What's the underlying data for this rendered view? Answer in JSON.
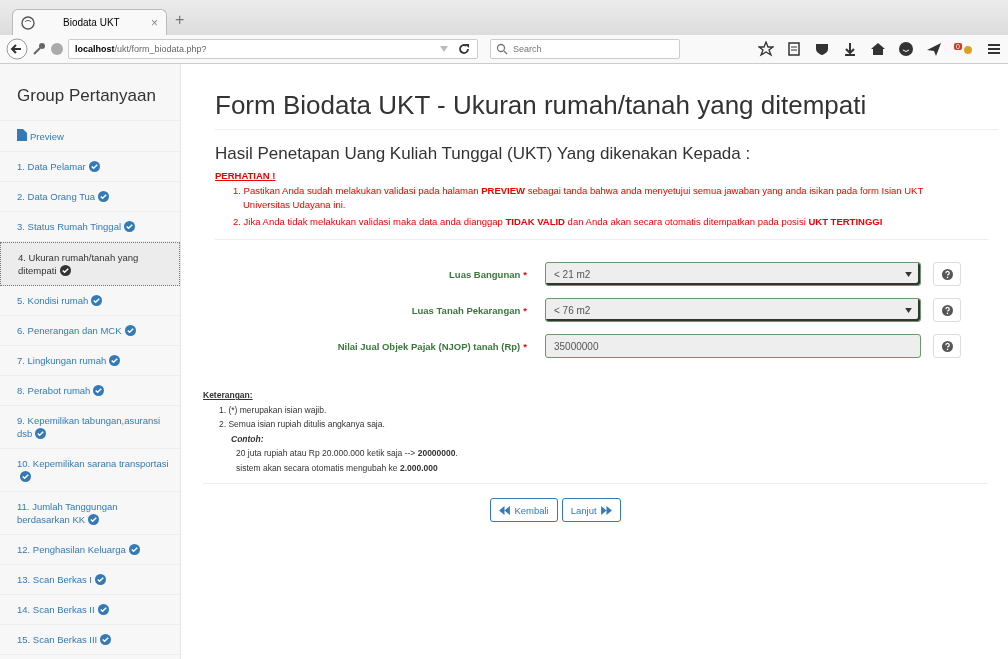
{
  "browser": {
    "tab_title": "Biodata UKT",
    "tab_close": "×",
    "new_tab": "+",
    "url_host": "localhost",
    "url_path": "/ukt/form_biodata.php?",
    "search_placeholder": "Search",
    "badge": "0"
  },
  "sidebar": {
    "title": "Group Pertanyaan",
    "items": [
      {
        "kind": "preview",
        "label": "Preview",
        "done": false,
        "selected": false
      },
      {
        "kind": "step",
        "label": "1. Data Pelamar",
        "done": true,
        "selected": false
      },
      {
        "kind": "step",
        "label": "2. Data Orang Tua",
        "done": true,
        "selected": false
      },
      {
        "kind": "step",
        "label": "3. Status Rumah Tinggal",
        "done": true,
        "selected": false
      },
      {
        "kind": "step",
        "label": "4. Ukuran rumah/tanah yang ditempati",
        "done": true,
        "selected": true
      },
      {
        "kind": "step",
        "label": "5. Kondisi rumah",
        "done": true,
        "selected": false
      },
      {
        "kind": "step",
        "label": "6. Penerangan dan MCK",
        "done": true,
        "selected": false
      },
      {
        "kind": "step",
        "label": "7. Lingkungan rumah",
        "done": true,
        "selected": false
      },
      {
        "kind": "step",
        "label": "8. Perabot rumah",
        "done": true,
        "selected": false
      },
      {
        "kind": "step",
        "label": "9. Kepemilikan tabungan,asuransi dsb",
        "done": true,
        "selected": false
      },
      {
        "kind": "step",
        "label": "10. Kepemilikan sarana transportasi",
        "done": true,
        "selected": false
      },
      {
        "kind": "step",
        "label": "11. Jumlah Tanggungan berdasarkan KK",
        "done": true,
        "selected": false
      },
      {
        "kind": "step",
        "label": "12. Penghasilan Keluarga",
        "done": true,
        "selected": false
      },
      {
        "kind": "step",
        "label": "13. Scan Berkas I",
        "done": true,
        "selected": false
      },
      {
        "kind": "step",
        "label": "14. Scan Berkas II",
        "done": true,
        "selected": false
      },
      {
        "kind": "step",
        "label": "15. Scan Berkas III",
        "done": true,
        "selected": false
      }
    ]
  },
  "main": {
    "required_mark": "*",
    "title": "Form Biodata UKT - Ukuran rumah/tanah yang ditempati",
    "subtitle": "Hasil Penetapan Uang Kuliah Tunggal (UKT) Yang dikenakan Kepada :",
    "warning_title": "PERHATIAN !",
    "warnings": [
      "1. Pastikan Anda sudah melakukan validasi pada halaman **PREVIEW** sebagai tanda bahwa anda menyetujui semua jawaban yang anda isikan pada form Isian UKT Universitas Udayana ini.",
      "2. Jika Anda tidak melakukan validasi maka data anda dianggap **TIDAK VALID** dan Anda akan secara otomatis ditempatkan pada posisi **UKT TERTINGGI**"
    ],
    "fields": [
      {
        "kind": "select",
        "label": "Luas Bangunan",
        "required": true,
        "value": "< 21 m2"
      },
      {
        "kind": "select",
        "label": "Luas Tanah Pekarangan",
        "required": true,
        "value": "< 76 m2"
      },
      {
        "kind": "input",
        "label": "Nilai Jual Objek Pajak (NJOP) tanah (Rp)",
        "required": true,
        "value": "35000000"
      }
    ],
    "notes_title": "Keterangan:",
    "notes": [
      "1. (*) merupakan isian wajib.",
      "2. Semua isian rupiah ditulis angkanya saja."
    ],
    "example_title": "Contoh:",
    "example_lines": [
      "20 juta rupiah atau Rp 20.000.000 ketik saja --> **20000000**.",
      "sistem akan secara otomatis mengubah ke **2.000.000**"
    ],
    "buttons": [
      {
        "kind": "back",
        "label": "Kembali"
      },
      {
        "kind": "next",
        "label": "Lanjut"
      }
    ]
  }
}
